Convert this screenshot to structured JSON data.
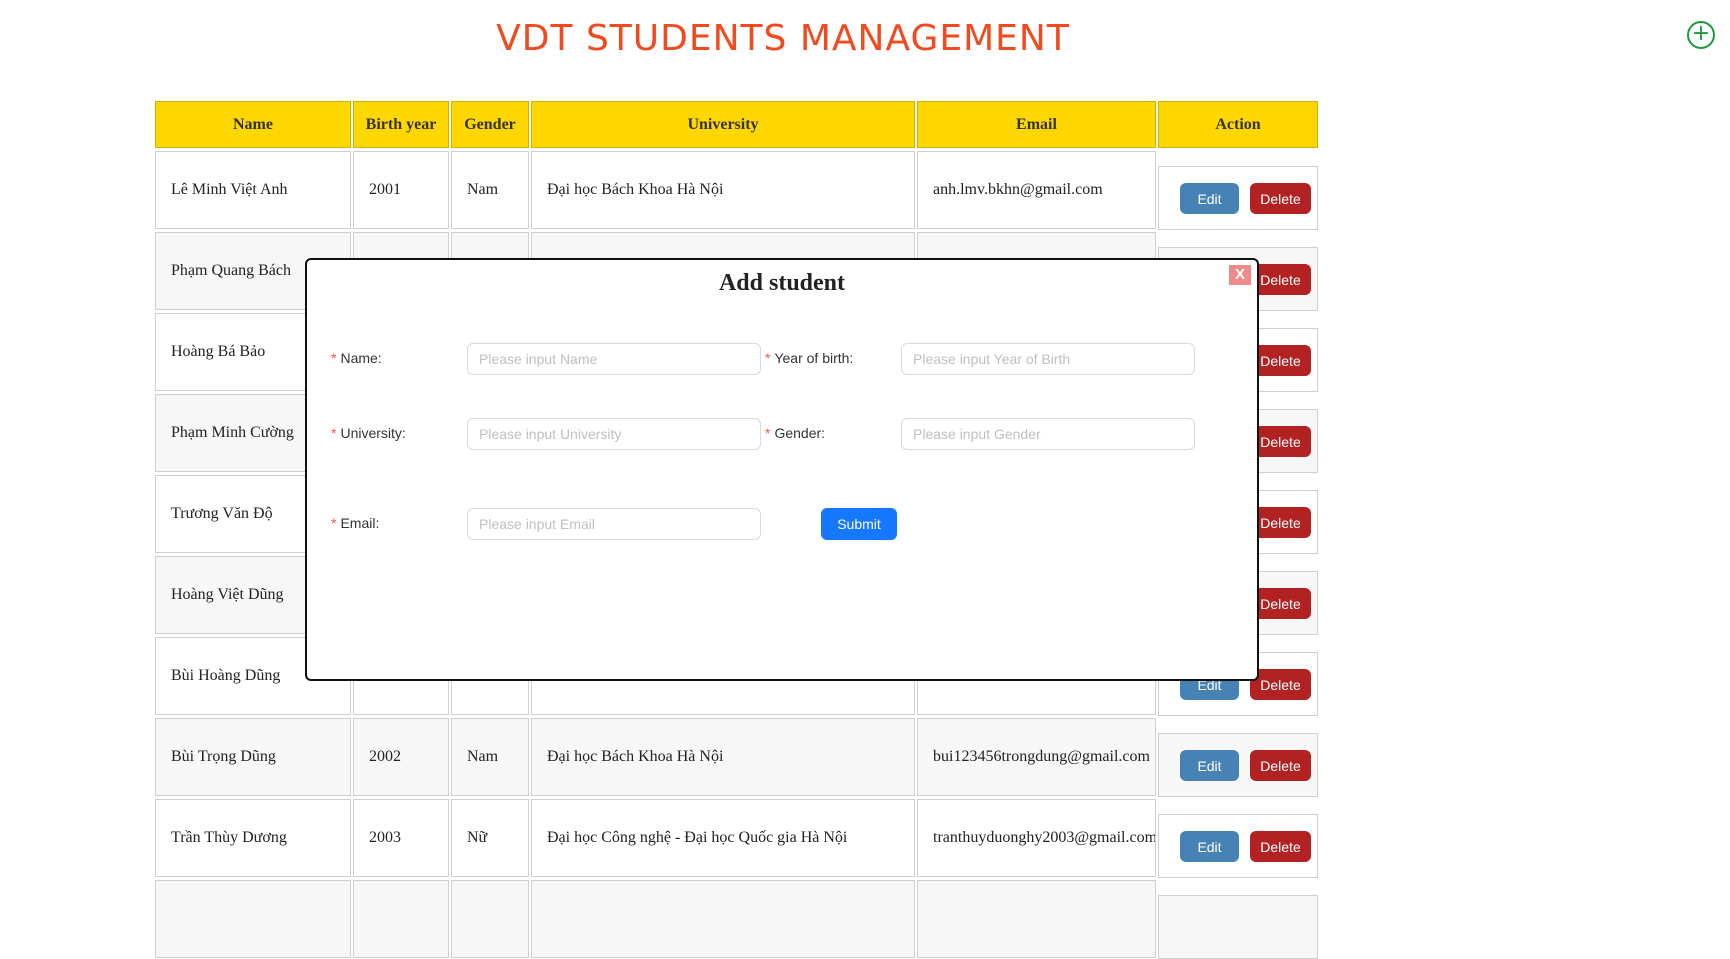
{
  "title": "VDT STUDENTS MANAGEMENT",
  "add_icon": "plus-circle-icon",
  "colors": {
    "header": "#ffd700",
    "edit": "#4682b4",
    "delete": "#b22222",
    "title": "#f04a1e",
    "submit": "#1677ff"
  },
  "table": {
    "headers": [
      "Name",
      "Birth year",
      "Gender",
      "University",
      "Email",
      "Action"
    ],
    "rows": [
      [
        "Lê Minh Việt Anh",
        "2001",
        "Nam",
        "Đại học Bách Khoa Hà Nội",
        "anh.lmv.bkhn@gmail.com"
      ],
      [
        "Phạm Quang Bách",
        "",
        "",
        "",
        ""
      ],
      [
        "Hoàng Bá Bảo",
        "",
        "",
        "",
        ""
      ],
      [
        "Phạm Minh Cường",
        "",
        "",
        "",
        ""
      ],
      [
        "Trương Văn Độ",
        "",
        "",
        "",
        ""
      ],
      [
        "Hoàng Việt Dũng",
        "",
        "",
        "",
        ""
      ],
      [
        "Bùi Hoàng Dũng",
        "",
        "",
        "",
        ""
      ],
      [
        "Bùi Trọng Dũng",
        "2002",
        "Nam",
        "Đại học Bách Khoa Hà Nội",
        "bui123456trongdung@gmail.com"
      ],
      [
        "Trần Thùy Dương",
        "2003",
        "Nữ",
        "Đại học Công nghệ - Đại học Quốc gia Hà Nội",
        "tranthuyduonghy2003@gmail.com"
      ],
      [
        "",
        "",
        "",
        "",
        ""
      ]
    ],
    "edit_label": "Edit",
    "delete_label": "Delete"
  },
  "modal": {
    "title": "Add student",
    "close_label": "X",
    "fields": [
      {
        "label": "Name:",
        "placeholder": "Please input Name"
      },
      {
        "label": "Year of birth:",
        "placeholder": "Please input Year of Birth"
      },
      {
        "label": "University:",
        "placeholder": "Please input University"
      },
      {
        "label": "Gender:",
        "placeholder": "Please input Gender"
      },
      {
        "label": "Email:",
        "placeholder": "Please input Email"
      }
    ],
    "required_mark": "*",
    "submit_label": "Submit"
  }
}
